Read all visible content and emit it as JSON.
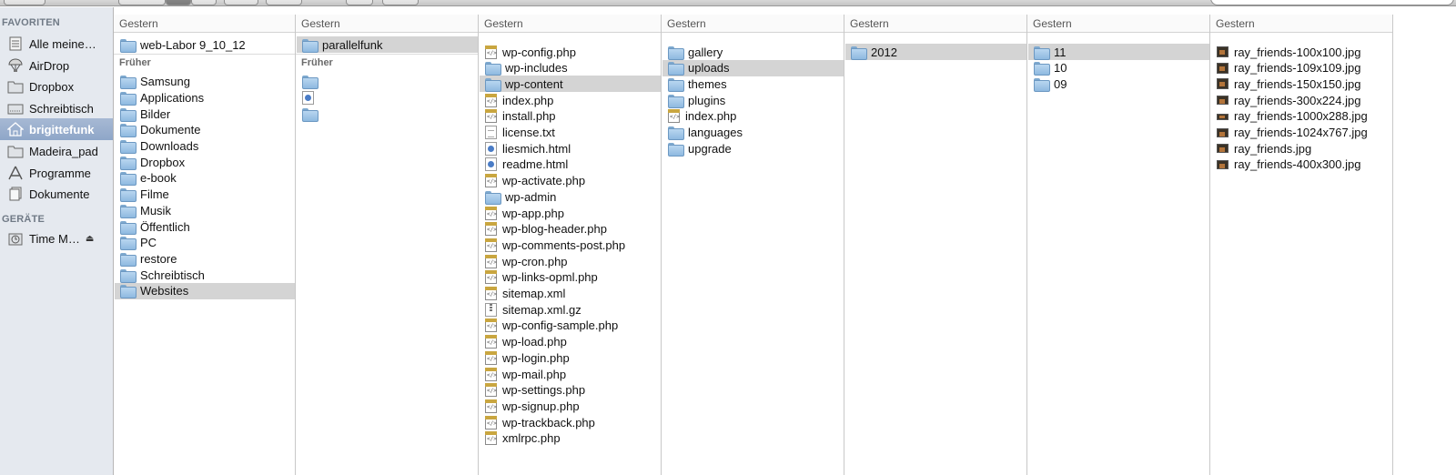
{
  "sidebar": {
    "favorites_header": "FAVORITEN",
    "devices_header": "GERÄTE",
    "items": [
      {
        "label": "Alle meine…",
        "icon": "all-files-icon"
      },
      {
        "label": "AirDrop",
        "icon": "airdrop-icon"
      },
      {
        "label": "Dropbox",
        "icon": "folder-icon"
      },
      {
        "label": "Schreibtisch",
        "icon": "desktop-icon"
      },
      {
        "label": "brigittefunk",
        "icon": "home-icon"
      },
      {
        "label": "Madeira_pad",
        "icon": "folder-icon"
      },
      {
        "label": "Programme",
        "icon": "applications-icon"
      },
      {
        "label": "Dokumente",
        "icon": "documents-icon"
      }
    ],
    "devices": [
      {
        "label": "Time M…",
        "icon": "time-machine-icon"
      }
    ],
    "selected_index": 4
  },
  "columns": [
    {
      "header": "Gestern",
      "recent": [
        {
          "label": "web-Labor 9_10_12",
          "type": "folder"
        }
      ],
      "older_header": "Früher",
      "older": [
        {
          "label": "Samsung",
          "type": "folder"
        },
        {
          "label": "Applications",
          "type": "folder"
        },
        {
          "label": "Bilder",
          "type": "folder"
        },
        {
          "label": "Dokumente",
          "type": "folder"
        },
        {
          "label": "Downloads",
          "type": "folder"
        },
        {
          "label": "Dropbox",
          "type": "folder"
        },
        {
          "label": "e-book",
          "type": "folder"
        },
        {
          "label": "Filme",
          "type": "folder"
        },
        {
          "label": "Musik",
          "type": "folder"
        },
        {
          "label": "Öffentlich",
          "type": "folder"
        },
        {
          "label": "PC",
          "type": "folder"
        },
        {
          "label": "restore",
          "type": "folder"
        },
        {
          "label": "Schreibtisch",
          "type": "folder"
        },
        {
          "label": "Websites",
          "type": "folder",
          "selected": true
        }
      ]
    },
    {
      "header": "Gestern",
      "recent": [
        {
          "label": "parallelfunk",
          "type": "folder",
          "selected": true
        }
      ],
      "older_header": "Früher",
      "older": [
        {
          "label": "",
          "type": "folder"
        },
        {
          "label": "",
          "type": "html"
        },
        {
          "label": "",
          "type": "folder"
        }
      ]
    },
    {
      "header": "Gestern",
      "items": [
        {
          "label": "wp-config.php",
          "type": "php"
        },
        {
          "label": "wp-includes",
          "type": "folder"
        },
        {
          "label": "wp-content",
          "type": "folder",
          "selected": true
        },
        {
          "label": "index.php",
          "type": "php"
        },
        {
          "label": "install.php",
          "type": "php"
        },
        {
          "label": "license.txt",
          "type": "doc"
        },
        {
          "label": "liesmich.html",
          "type": "html"
        },
        {
          "label": "readme.html",
          "type": "html"
        },
        {
          "label": "wp-activate.php",
          "type": "php"
        },
        {
          "label": "wp-admin",
          "type": "folder"
        },
        {
          "label": "wp-app.php",
          "type": "php"
        },
        {
          "label": "wp-blog-header.php",
          "type": "php"
        },
        {
          "label": "wp-comments-post.php",
          "type": "php"
        },
        {
          "label": "wp-cron.php",
          "type": "php"
        },
        {
          "label": "wp-links-opml.php",
          "type": "php"
        },
        {
          "label": "sitemap.xml",
          "type": "php"
        },
        {
          "label": "sitemap.xml.gz",
          "type": "gz"
        },
        {
          "label": "wp-config-sample.php",
          "type": "php"
        },
        {
          "label": "wp-load.php",
          "type": "php"
        },
        {
          "label": "wp-login.php",
          "type": "php"
        },
        {
          "label": "wp-mail.php",
          "type": "php"
        },
        {
          "label": "wp-settings.php",
          "type": "php"
        },
        {
          "label": "wp-signup.php",
          "type": "php"
        },
        {
          "label": "wp-trackback.php",
          "type": "php"
        },
        {
          "label": "xmlrpc.php",
          "type": "php"
        }
      ]
    },
    {
      "header": "Gestern",
      "items": [
        {
          "label": "gallery",
          "type": "folder"
        },
        {
          "label": "uploads",
          "type": "folder",
          "selected": true
        },
        {
          "label": "themes",
          "type": "folder"
        },
        {
          "label": "plugins",
          "type": "folder"
        },
        {
          "label": "index.php",
          "type": "php"
        },
        {
          "label": "languages",
          "type": "folder"
        },
        {
          "label": "upgrade",
          "type": "folder"
        }
      ]
    },
    {
      "header": "Gestern",
      "items": [
        {
          "label": "2012",
          "type": "folder",
          "selected": true
        }
      ]
    },
    {
      "header": "Gestern",
      "items": [
        {
          "label": "11",
          "type": "folder",
          "selected": true
        },
        {
          "label": "10",
          "type": "folder"
        },
        {
          "label": "09",
          "type": "folder"
        }
      ]
    },
    {
      "header": "Gestern",
      "items": [
        {
          "label": "ray_friends-100x100.jpg",
          "type": "img"
        },
        {
          "label": "ray_friends-109x109.jpg",
          "type": "img"
        },
        {
          "label": "ray_friends-150x150.jpg",
          "type": "img"
        },
        {
          "label": "ray_friends-300x224.jpg",
          "type": "img-mid"
        },
        {
          "label": "ray_friends-1000x288.jpg",
          "type": "img-wide"
        },
        {
          "label": "ray_friends-1024x767.jpg",
          "type": "img-mid"
        },
        {
          "label": "ray_friends.jpg",
          "type": "img-mid"
        },
        {
          "label": "ray_friends-400x300.jpg",
          "type": "img-mid"
        }
      ]
    }
  ]
}
